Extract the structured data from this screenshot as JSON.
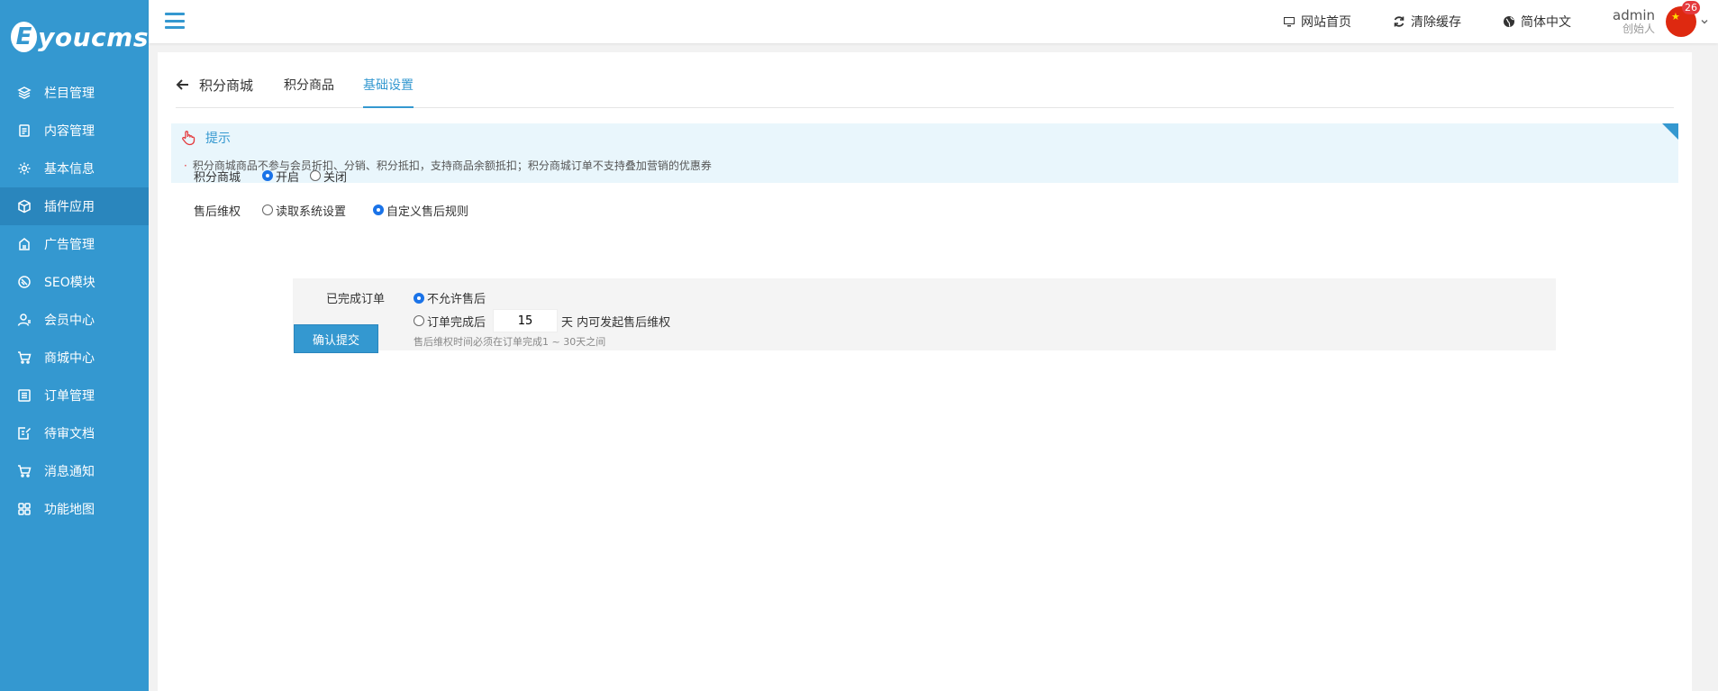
{
  "brand": {
    "logo_letter": "E",
    "logo_text": "youcms"
  },
  "sidebar": {
    "items": [
      {
        "label": "栏目管理",
        "icon": "layers-icon"
      },
      {
        "label": "内容管理",
        "icon": "document-icon"
      },
      {
        "label": "基本信息",
        "icon": "gear-icon"
      },
      {
        "label": "插件应用",
        "icon": "cube-icon",
        "active": true
      },
      {
        "label": "广告管理",
        "icon": "ad-icon"
      },
      {
        "label": "SEO模块",
        "icon": "seo-icon"
      },
      {
        "label": "会员中心",
        "icon": "user-icon"
      },
      {
        "label": "商城中心",
        "icon": "cart-icon"
      },
      {
        "label": "订单管理",
        "icon": "list-icon"
      },
      {
        "label": "待审文档",
        "icon": "edit-doc-icon"
      },
      {
        "label": "消息通知",
        "icon": "cart-icon"
      },
      {
        "label": "功能地图",
        "icon": "grid-icon"
      }
    ]
  },
  "topbar": {
    "links": {
      "home": "网站首页",
      "clear_cache": "清除缓存",
      "language": "简体中文"
    },
    "user": {
      "name": "admin",
      "role": "创始人",
      "badge": "26"
    }
  },
  "tabs": {
    "back_label": "积分商城",
    "items": [
      "积分商品",
      "基础设置"
    ],
    "active_index": 1
  },
  "tip": {
    "title": "提示",
    "text": "积分商城商品不参与会员折扣、分销、积分抵扣，支持商品余额抵扣；积分商城订单不支持叠加营销的优惠券"
  },
  "form": {
    "mall": {
      "label": "积分商城",
      "options": [
        "开启",
        "关闭"
      ],
      "selected": 0
    },
    "after_sale": {
      "label": "售后维权",
      "options": [
        "读取系统设置",
        "自定义售后规则"
      ],
      "selected": 1
    },
    "completed": {
      "label": "已完成订单",
      "option_disallow": "不允许售后",
      "option_after_prefix": "订单完成后",
      "days_value": "15",
      "option_after_suffix": "天 内可发起售后维权",
      "hint": "售后维权时间必须在订单完成1 ~ 30天之间",
      "selected": 0
    },
    "submit_label": "确认提交"
  },
  "colors": {
    "primary": "#3498d0",
    "sidebar_active": "#2a86bd",
    "tip_bg": "#e9f6fc",
    "radio_checked": "#1a73e8"
  }
}
